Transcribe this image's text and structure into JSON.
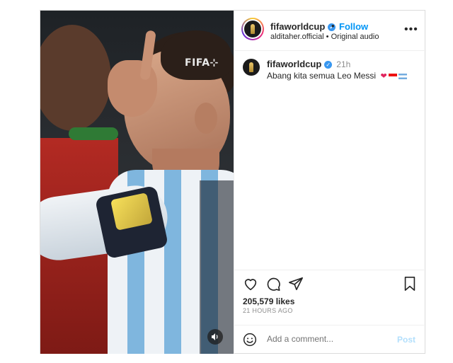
{
  "media": {
    "watermark": "FIFA⊹",
    "sound_icon": "speaker-icon"
  },
  "header": {
    "username": "fifaworldcup",
    "separator": "•",
    "follow_label": "Follow",
    "audio_owner": "alditaher.official",
    "audio_sep": " • ",
    "audio_label": "Original audio",
    "more_label": "•••"
  },
  "caption": {
    "username": "fifaworldcup",
    "time": "21h",
    "text": "Abang kita semua Leo Messi"
  },
  "actions": {
    "likes": "205,579 likes",
    "time_ago": "21 HOURS AGO"
  },
  "comment": {
    "placeholder": "Add a comment...",
    "post_label": "Post"
  },
  "colors": {
    "accent": "#0095f6",
    "verified": "#3897f0",
    "post_disabled": "#b2dffc"
  }
}
